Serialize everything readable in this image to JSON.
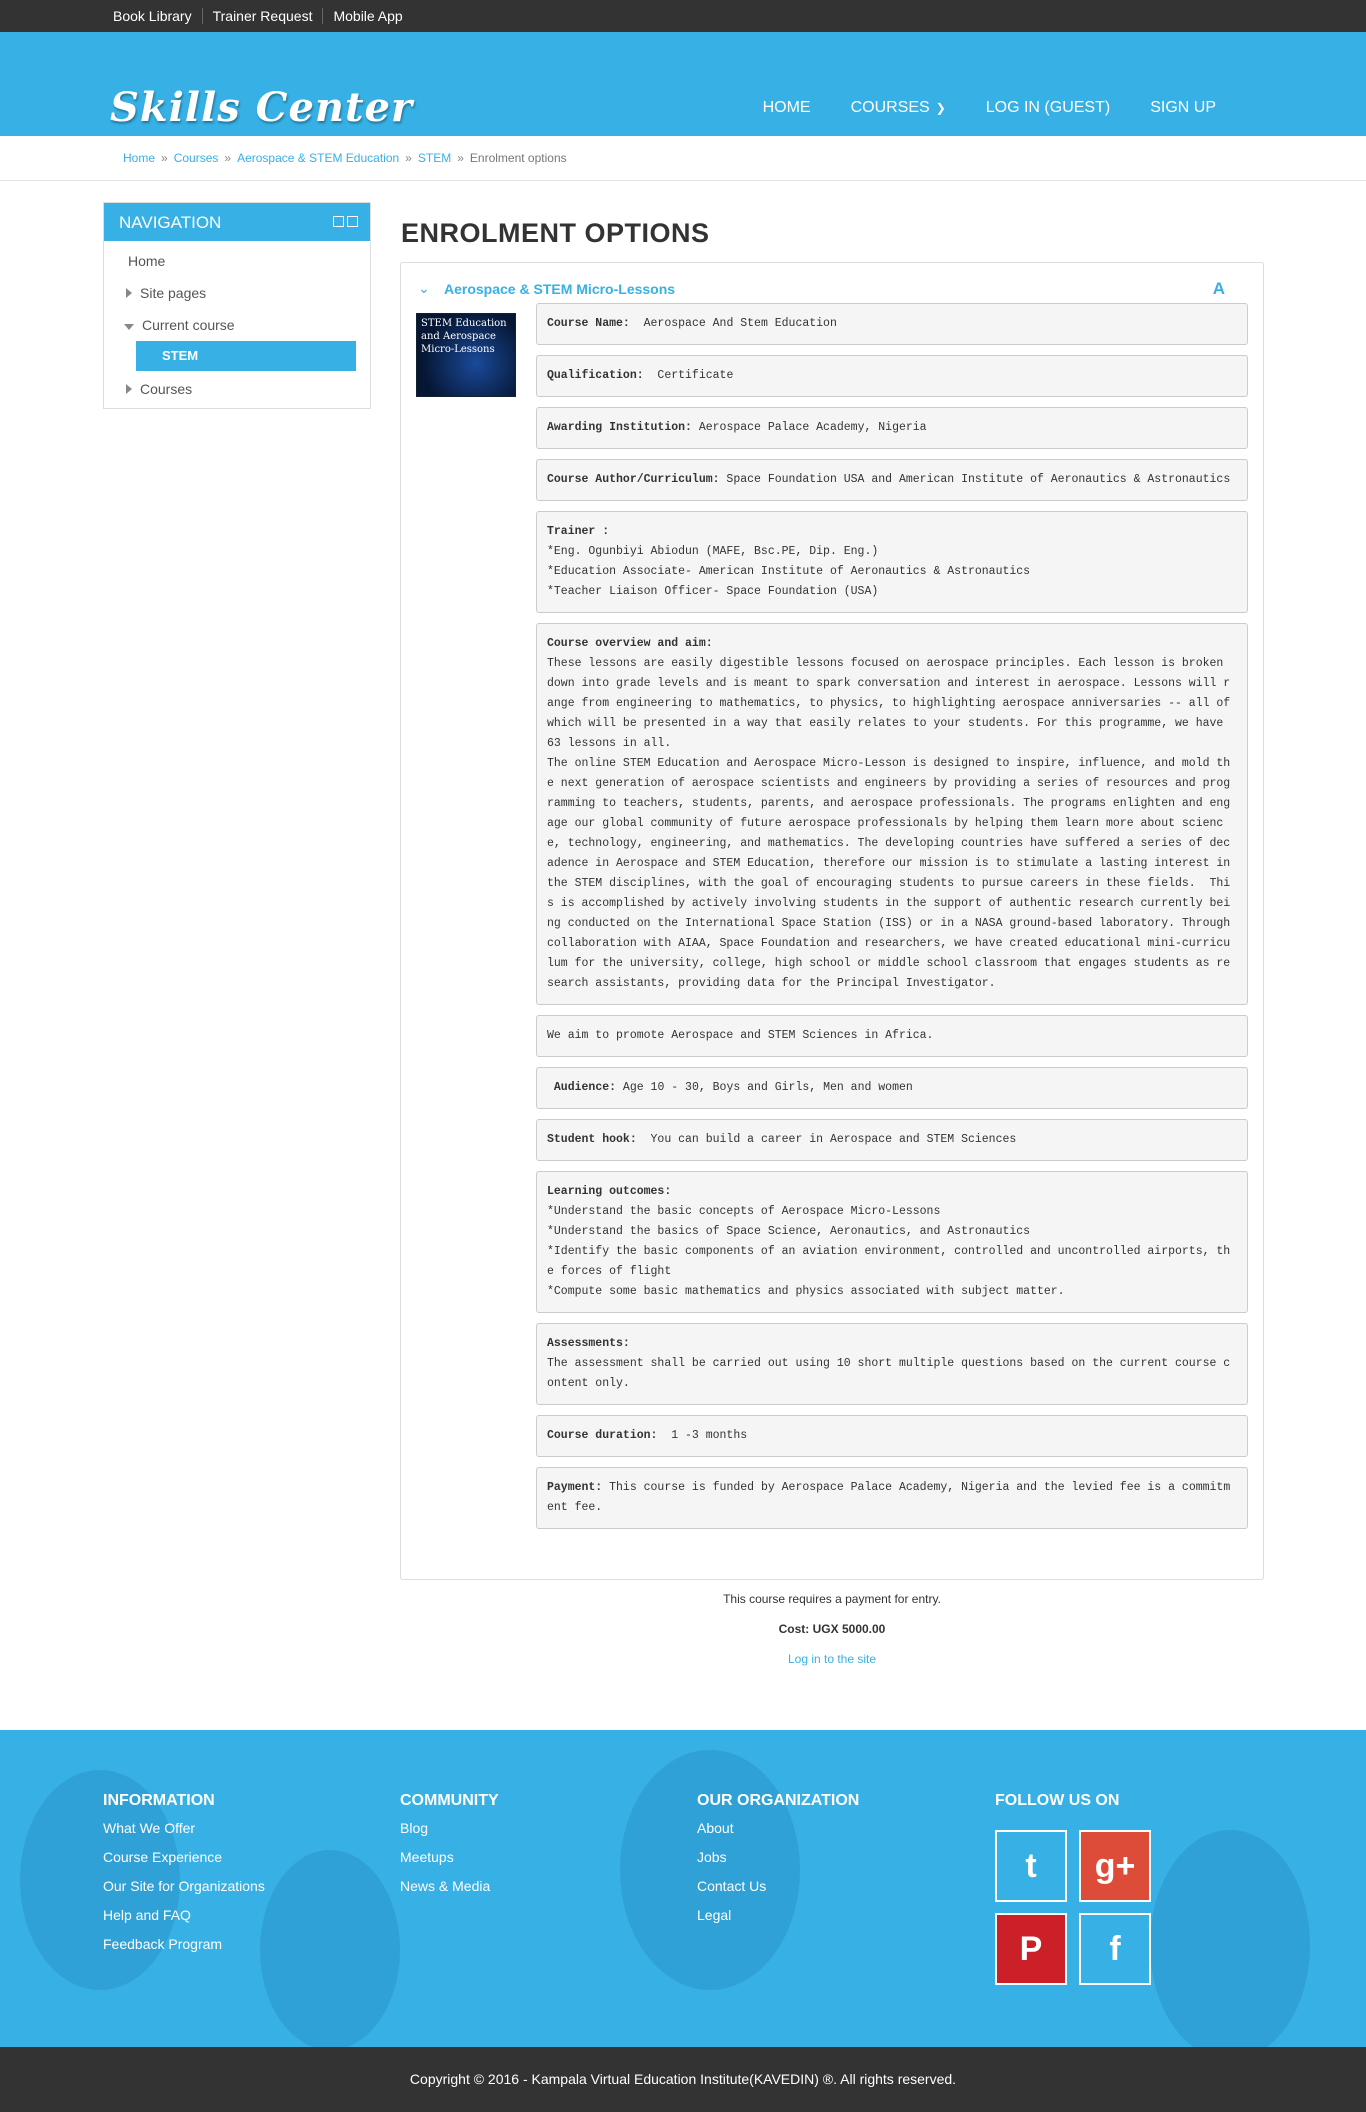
{
  "topbar": {
    "links": [
      "Book Library",
      "Trainer Request",
      "Mobile App"
    ]
  },
  "header": {
    "logo": "Skills Center",
    "nav": [
      "HOME",
      "COURSES",
      "LOG IN (GUEST)",
      "SIGN UP"
    ]
  },
  "breadcrumb": [
    "Home",
    "Courses",
    "Aerospace & STEM Education",
    "STEM",
    "Enrolment options"
  ],
  "navigation": {
    "title": "NAVIGATION",
    "items": [
      "Home",
      "Site pages",
      "Current course",
      "STEM",
      "Courses"
    ]
  },
  "page": {
    "title": "ENROLMENT OPTIONS"
  },
  "course": {
    "name": "Aerospace & STEM Micro-Lessons",
    "image_text": "STEM Education and Aerospace Micro-Lessons",
    "fields": [
      {
        "label": "Course Name:",
        "text": "  Aerospace And Stem Education"
      },
      {
        "label": "Qualification:",
        "text": "  Certificate"
      },
      {
        "label": "Awarding Institution:",
        "text": " Aerospace Palace Academy, Nigeria"
      },
      {
        "label": "Course Author/Curriculum:",
        "text": " Space Foundation USA and American Institute of Aeronautics & Astronautics"
      },
      {
        "label": "Trainer :",
        "text": "\n*Eng. Ogunbiyi Abiodun (MAFE, Bsc.PE, Dip. Eng.)\n*Education Associate- American Institute of Aeronautics & Astronautics\n*Teacher Liaison Officer- Space Foundation (USA)"
      },
      {
        "label": "Course overview and aim:",
        "text": "\nThese lessons are easily digestible lessons focused on aerospace principles. Each lesson is broken down into grade levels and is meant to spark conversation and interest in aerospace. Lessons will range from engineering to mathematics, to physics, to highlighting aerospace anniversaries -- all of which will be presented in a way that easily relates to your students. For this programme, we have 63 lessons in all.\nThe online STEM Education and Aerospace Micro-Lesson is designed to inspire, influence, and mold the next generation of aerospace scientists and engineers by providing a series of resources and programming to teachers, students, parents, and aerospace professionals. The programs enlighten and engage our global community of future aerospace professionals by helping them learn more about science, technology, engineering, and mathematics. The developing countries have suffered a series of decadence in Aerospace and STEM Education, therefore our mission is to stimulate a lasting interest in the STEM disciplines, with the goal of encouraging students to pursue careers in these fields.  This is accomplished by actively involving students in the support of authentic research currently being conducted on the International Space Station (ISS) or in a NASA ground-based laboratory. Through collaboration with AIAA, Space Foundation and researchers, we have created educational mini-curriculum for the university, college, high school or middle school classroom that engages students as research assistants, providing data for the Principal Investigator."
      },
      {
        "label": "",
        "text": "We aim to promote Aerospace and STEM Sciences in Africa."
      },
      {
        "label": " Audience:",
        "text": " Age 10 - 30, Boys and Girls, Men and women"
      },
      {
        "label": "Student hook:",
        "text": "  You can build a career in Aerospace and STEM Sciences"
      },
      {
        "label": "Learning outcomes:",
        "text": "\n*Understand the basic concepts of Aerospace Micro-Lessons\n*Understand the basics of Space Science, Aeronautics, and Astronautics\n*Identify the basic components of an aviation environment, controlled and uncontrolled airports, the forces of flight\n*Compute some basic mathematics and physics associated with subject matter."
      },
      {
        "label": "Assessments:",
        "text": "\nThe assessment shall be carried out using 10 short multiple questions based on the current course content only."
      },
      {
        "label": "Course duration:",
        "text": "  1 -3 months"
      },
      {
        "label": "Payment:",
        "text": " This course is funded by Aerospace Palace Academy, Nigeria and the levied fee is a commitment fee."
      }
    ]
  },
  "payment": {
    "notice": "This course requires a payment for entry.",
    "cost": "Cost: UGX 5000.00",
    "login_link": "Log in to the site"
  },
  "footer": {
    "columns": [
      {
        "title": "INFORMATION",
        "links": [
          "What We Offer",
          "Course Experience",
          "Our Site for Organizations",
          "Help and FAQ",
          "Feedback Program"
        ]
      },
      {
        "title": "COMMUNITY",
        "links": [
          "Blog",
          "Meetups",
          "News & Media"
        ]
      },
      {
        "title": "OUR ORGANIZATION",
        "links": [
          "About",
          "Jobs",
          "Contact Us",
          "Legal"
        ]
      },
      {
        "title": "FOLLOW US ON",
        "links": []
      }
    ],
    "social": [
      {
        "icon": "twitter-icon",
        "color": "#36b0e5",
        "glyph": "t"
      },
      {
        "icon": "google-plus-icon",
        "color": "#dd4b39",
        "glyph": "g+"
      },
      {
        "icon": "pinterest-icon",
        "color": "#cb2027",
        "glyph": "P"
      },
      {
        "icon": "facebook-icon",
        "color": "#36b0e5",
        "glyph": "f"
      }
    ],
    "copyright": "Copyright © 2016 - Kampala Virtual Education Institute(KAVEDIN) ®. All rights reserved."
  }
}
